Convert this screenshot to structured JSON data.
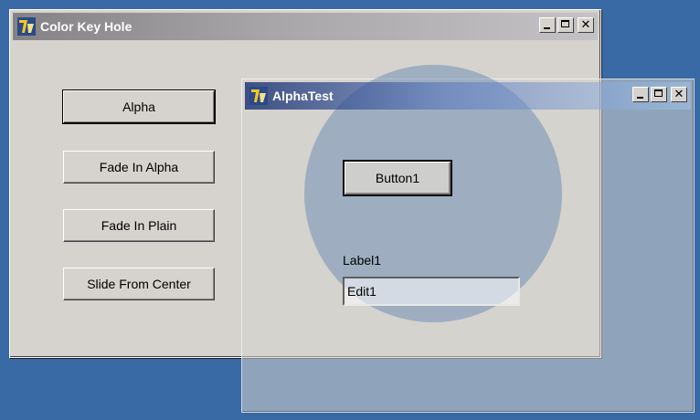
{
  "main_window": {
    "title": "Color Key Hole",
    "buttons": [
      {
        "label": "Alpha"
      },
      {
        "label": "Fade In Alpha"
      },
      {
        "label": "Fade In Plain"
      },
      {
        "label": "Slide From Center"
      }
    ]
  },
  "alpha_window": {
    "title": "AlphaTest",
    "button1_label": "Button1",
    "label1": "Label1",
    "edit1_value": "Edit1"
  },
  "colors": {
    "desktop": "#3a6aa5",
    "window_face": "#d6d3ce",
    "active_titlebar": "#0a246a",
    "inactive_titlebar": "#848284"
  },
  "icons": {
    "app": "delphi-icon",
    "minimize": "minimize-icon",
    "maximize": "maximize-icon",
    "close": "close-icon"
  }
}
